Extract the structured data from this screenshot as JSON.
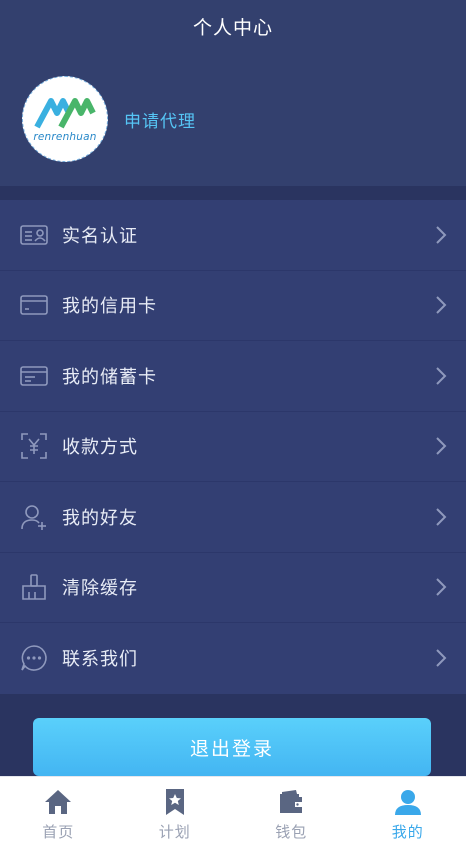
{
  "header": {
    "title": "个人中心"
  },
  "profile": {
    "avatar_text": "renrenhuan",
    "apply_label": "申请代理"
  },
  "menu": {
    "items": [
      {
        "label": "实名认证",
        "icon": "id-card-icon"
      },
      {
        "label": "我的信用卡",
        "icon": "credit-card-icon"
      },
      {
        "label": "我的储蓄卡",
        "icon": "debit-card-icon"
      },
      {
        "label": "收款方式",
        "icon": "yuan-scan-icon"
      },
      {
        "label": "我的好友",
        "icon": "user-add-icon"
      },
      {
        "label": "清除缓存",
        "icon": "broom-icon"
      },
      {
        "label": "联系我们",
        "icon": "chat-icon"
      }
    ]
  },
  "logout": {
    "label": "退出登录"
  },
  "tabbar": {
    "items": [
      {
        "label": "首页",
        "icon": "home-icon",
        "active": false
      },
      {
        "label": "计划",
        "icon": "bookmark-icon",
        "active": false
      },
      {
        "label": "钱包",
        "icon": "wallet-icon",
        "active": false
      },
      {
        "label": "我的",
        "icon": "profile-icon",
        "active": true
      }
    ]
  },
  "colors": {
    "background": "#2f3a66",
    "accent": "#56c5f5",
    "button": "#4fc3f7",
    "tab_active": "#3aa8ea",
    "tab_inactive": "#9aa1b3"
  }
}
